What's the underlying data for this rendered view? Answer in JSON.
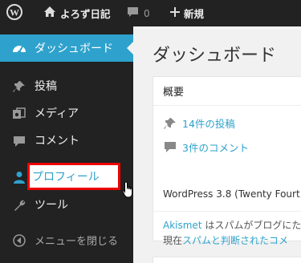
{
  "admin_bar": {
    "site_name": "よろず日記",
    "comment_count": "0",
    "new_label": "新規",
    "icons": [
      "wordpress-logo-icon",
      "home-icon",
      "comment-bubble-icon",
      "plus-icon"
    ]
  },
  "sidebar": {
    "items": [
      {
        "label": "ダッシュボード",
        "icon": "dashboard-icon"
      },
      {
        "label": "投稿",
        "icon": "pin-icon"
      },
      {
        "label": "メディア",
        "icon": "media-icon"
      },
      {
        "label": "コメント",
        "icon": "comment-icon"
      },
      {
        "label": "プロフィール",
        "icon": "user-icon"
      },
      {
        "label": "ツール",
        "icon": "wrench-icon"
      },
      {
        "label": "メニューを閉じる",
        "icon": "collapse-icon"
      }
    ]
  },
  "main": {
    "title": "ダッシュボード",
    "glance": {
      "heading": "概要",
      "posts": "14件の投稿",
      "comments": "3件のコメント",
      "version": "WordPress 3.8 (Twenty Fourt"
    },
    "akismet": {
      "line1_link": "Akismet",
      "line1_text": " はスパムがブログにた",
      "line2_text": "現在",
      "line2_link": "スパムと判断されたコメ"
    }
  },
  "colors": {
    "admin_bar_bg": "#222222",
    "accent": "#2ea2cc",
    "highlight_border": "#ee0000",
    "page_bg": "#f1f1f1"
  }
}
